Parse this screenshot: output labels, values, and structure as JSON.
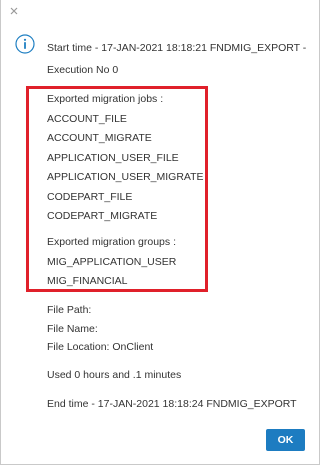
{
  "header": {
    "start_line1": "Start time - 17-JAN-2021 18:18:21 FNDMIG_EXPORT -",
    "start_line2": "Execution No 0"
  },
  "jobs": {
    "heading": "Exported migration jobs :",
    "items": [
      "ACCOUNT_FILE",
      "ACCOUNT_MIGRATE",
      "APPLICATION_USER_FILE",
      "APPLICATION_USER_MIGRATE",
      "CODEPART_FILE",
      "CODEPART_MIGRATE"
    ]
  },
  "groups": {
    "heading": "Exported migration groups :",
    "items": [
      "MIG_APPLICATION_USER",
      "MIG_FINANCIAL"
    ]
  },
  "file_info": {
    "path": "File Path:",
    "name": "File Name:",
    "location": "File Location: OnClient"
  },
  "duration": "Used 0 hours and .1 minutes",
  "end_line": "End time - 17-JAN-2021 18:18:24 FNDMIG_EXPORT",
  "buttons": {
    "ok_label": "OK"
  },
  "colors": {
    "accent": "#1d7cc1",
    "highlight": "#e0202a",
    "info_icon": "#1f7fc2"
  },
  "icons": {
    "info": "info-circle-icon",
    "close": "close-icon"
  }
}
